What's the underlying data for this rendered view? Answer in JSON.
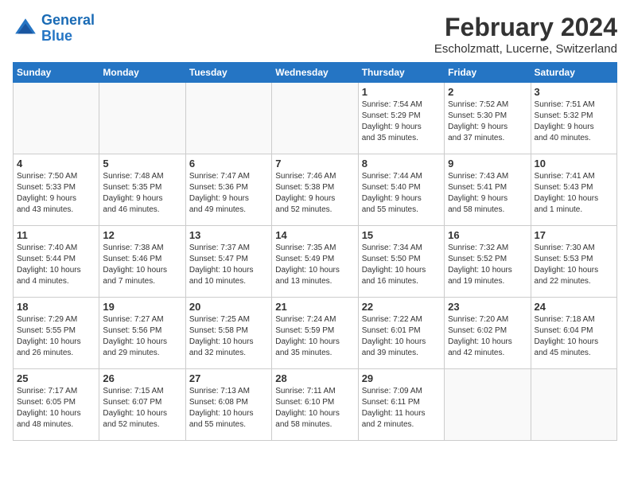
{
  "logo": {
    "text_general": "General",
    "text_blue": "Blue"
  },
  "title": "February 2024",
  "subtitle": "Escholzmatt, Lucerne, Switzerland",
  "days_of_week": [
    "Sunday",
    "Monday",
    "Tuesday",
    "Wednesday",
    "Thursday",
    "Friday",
    "Saturday"
  ],
  "weeks": [
    [
      {
        "day": "",
        "info": ""
      },
      {
        "day": "",
        "info": ""
      },
      {
        "day": "",
        "info": ""
      },
      {
        "day": "",
        "info": ""
      },
      {
        "day": "1",
        "info": "Sunrise: 7:54 AM\nSunset: 5:29 PM\nDaylight: 9 hours\nand 35 minutes."
      },
      {
        "day": "2",
        "info": "Sunrise: 7:52 AM\nSunset: 5:30 PM\nDaylight: 9 hours\nand 37 minutes."
      },
      {
        "day": "3",
        "info": "Sunrise: 7:51 AM\nSunset: 5:32 PM\nDaylight: 9 hours\nand 40 minutes."
      }
    ],
    [
      {
        "day": "4",
        "info": "Sunrise: 7:50 AM\nSunset: 5:33 PM\nDaylight: 9 hours\nand 43 minutes."
      },
      {
        "day": "5",
        "info": "Sunrise: 7:48 AM\nSunset: 5:35 PM\nDaylight: 9 hours\nand 46 minutes."
      },
      {
        "day": "6",
        "info": "Sunrise: 7:47 AM\nSunset: 5:36 PM\nDaylight: 9 hours\nand 49 minutes."
      },
      {
        "day": "7",
        "info": "Sunrise: 7:46 AM\nSunset: 5:38 PM\nDaylight: 9 hours\nand 52 minutes."
      },
      {
        "day": "8",
        "info": "Sunrise: 7:44 AM\nSunset: 5:40 PM\nDaylight: 9 hours\nand 55 minutes."
      },
      {
        "day": "9",
        "info": "Sunrise: 7:43 AM\nSunset: 5:41 PM\nDaylight: 9 hours\nand 58 minutes."
      },
      {
        "day": "10",
        "info": "Sunrise: 7:41 AM\nSunset: 5:43 PM\nDaylight: 10 hours\nand 1 minute."
      }
    ],
    [
      {
        "day": "11",
        "info": "Sunrise: 7:40 AM\nSunset: 5:44 PM\nDaylight: 10 hours\nand 4 minutes."
      },
      {
        "day": "12",
        "info": "Sunrise: 7:38 AM\nSunset: 5:46 PM\nDaylight: 10 hours\nand 7 minutes."
      },
      {
        "day": "13",
        "info": "Sunrise: 7:37 AM\nSunset: 5:47 PM\nDaylight: 10 hours\nand 10 minutes."
      },
      {
        "day": "14",
        "info": "Sunrise: 7:35 AM\nSunset: 5:49 PM\nDaylight: 10 hours\nand 13 minutes."
      },
      {
        "day": "15",
        "info": "Sunrise: 7:34 AM\nSunset: 5:50 PM\nDaylight: 10 hours\nand 16 minutes."
      },
      {
        "day": "16",
        "info": "Sunrise: 7:32 AM\nSunset: 5:52 PM\nDaylight: 10 hours\nand 19 minutes."
      },
      {
        "day": "17",
        "info": "Sunrise: 7:30 AM\nSunset: 5:53 PM\nDaylight: 10 hours\nand 22 minutes."
      }
    ],
    [
      {
        "day": "18",
        "info": "Sunrise: 7:29 AM\nSunset: 5:55 PM\nDaylight: 10 hours\nand 26 minutes."
      },
      {
        "day": "19",
        "info": "Sunrise: 7:27 AM\nSunset: 5:56 PM\nDaylight: 10 hours\nand 29 minutes."
      },
      {
        "day": "20",
        "info": "Sunrise: 7:25 AM\nSunset: 5:58 PM\nDaylight: 10 hours\nand 32 minutes."
      },
      {
        "day": "21",
        "info": "Sunrise: 7:24 AM\nSunset: 5:59 PM\nDaylight: 10 hours\nand 35 minutes."
      },
      {
        "day": "22",
        "info": "Sunrise: 7:22 AM\nSunset: 6:01 PM\nDaylight: 10 hours\nand 39 minutes."
      },
      {
        "day": "23",
        "info": "Sunrise: 7:20 AM\nSunset: 6:02 PM\nDaylight: 10 hours\nand 42 minutes."
      },
      {
        "day": "24",
        "info": "Sunrise: 7:18 AM\nSunset: 6:04 PM\nDaylight: 10 hours\nand 45 minutes."
      }
    ],
    [
      {
        "day": "25",
        "info": "Sunrise: 7:17 AM\nSunset: 6:05 PM\nDaylight: 10 hours\nand 48 minutes."
      },
      {
        "day": "26",
        "info": "Sunrise: 7:15 AM\nSunset: 6:07 PM\nDaylight: 10 hours\nand 52 minutes."
      },
      {
        "day": "27",
        "info": "Sunrise: 7:13 AM\nSunset: 6:08 PM\nDaylight: 10 hours\nand 55 minutes."
      },
      {
        "day": "28",
        "info": "Sunrise: 7:11 AM\nSunset: 6:10 PM\nDaylight: 10 hours\nand 58 minutes."
      },
      {
        "day": "29",
        "info": "Sunrise: 7:09 AM\nSunset: 6:11 PM\nDaylight: 11 hours\nand 2 minutes."
      },
      {
        "day": "",
        "info": ""
      },
      {
        "day": "",
        "info": ""
      }
    ]
  ]
}
